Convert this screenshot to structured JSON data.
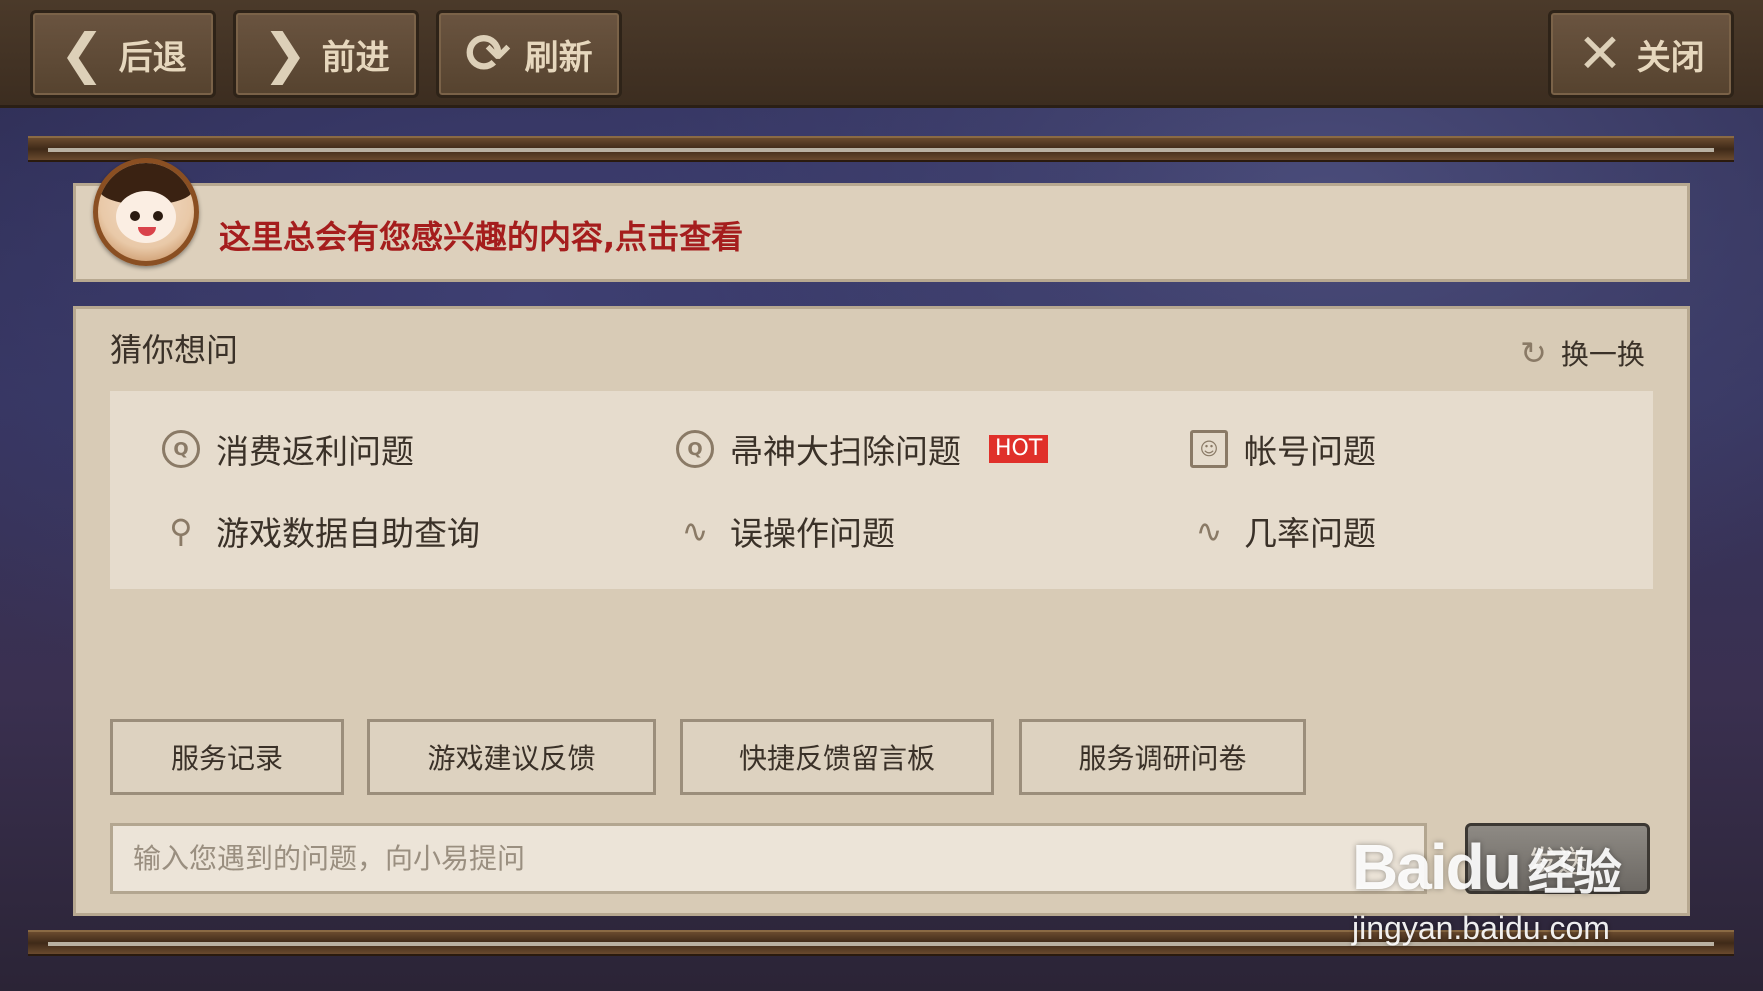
{
  "toolbar": {
    "back": {
      "icon": "chevron-left-icon",
      "glyph": "❮",
      "label": "后退"
    },
    "forward": {
      "icon": "chevron-right-icon",
      "glyph": "❯",
      "label": "前进"
    },
    "refresh": {
      "icon": "refresh-icon",
      "glyph": "⟳",
      "label": "刷新"
    },
    "close": {
      "icon": "close-icon",
      "glyph": "✕",
      "label": "关闭"
    }
  },
  "notice": {
    "text": "这里总会有您感兴趣的内容,点击查看"
  },
  "guess": {
    "title": "猜你想问",
    "swap_label": "换一换",
    "swap_glyph": "↻",
    "questions": [
      {
        "label": "消费返利问题",
        "icon": "question-circle-icon",
        "glyph": "Q"
      },
      {
        "label": "帚神大扫除问题",
        "icon": "question-circle-icon",
        "glyph": "Q",
        "badge": "HOT"
      },
      {
        "label": "帐号问题",
        "icon": "account-icon",
        "glyph": "☺"
      },
      {
        "label": "游戏数据自助查询",
        "icon": "search-icon",
        "glyph": "⚲"
      },
      {
        "label": "误操作问题",
        "icon": "pulse-icon",
        "glyph": "∿"
      },
      {
        "label": "几率问题",
        "icon": "pulse-icon",
        "glyph": "∿"
      }
    ]
  },
  "actions": [
    {
      "label": "服务记录"
    },
    {
      "label": "游戏建议反馈"
    },
    {
      "label": "快捷反馈留言板"
    },
    {
      "label": "服务调研问卷"
    }
  ],
  "ask": {
    "placeholder": "输入您遇到的问题，向小易提问",
    "send_label": "发送"
  },
  "watermark": {
    "logo": "Baidu",
    "logo_suffix": "经验",
    "url": "jingyan.baidu.com"
  },
  "colors": {
    "notice_text": "#a51d1d",
    "hot_badge": "#e0302a",
    "panel_bg": "#d8cbb6",
    "toolbar_bg": "#4b3a2a"
  }
}
